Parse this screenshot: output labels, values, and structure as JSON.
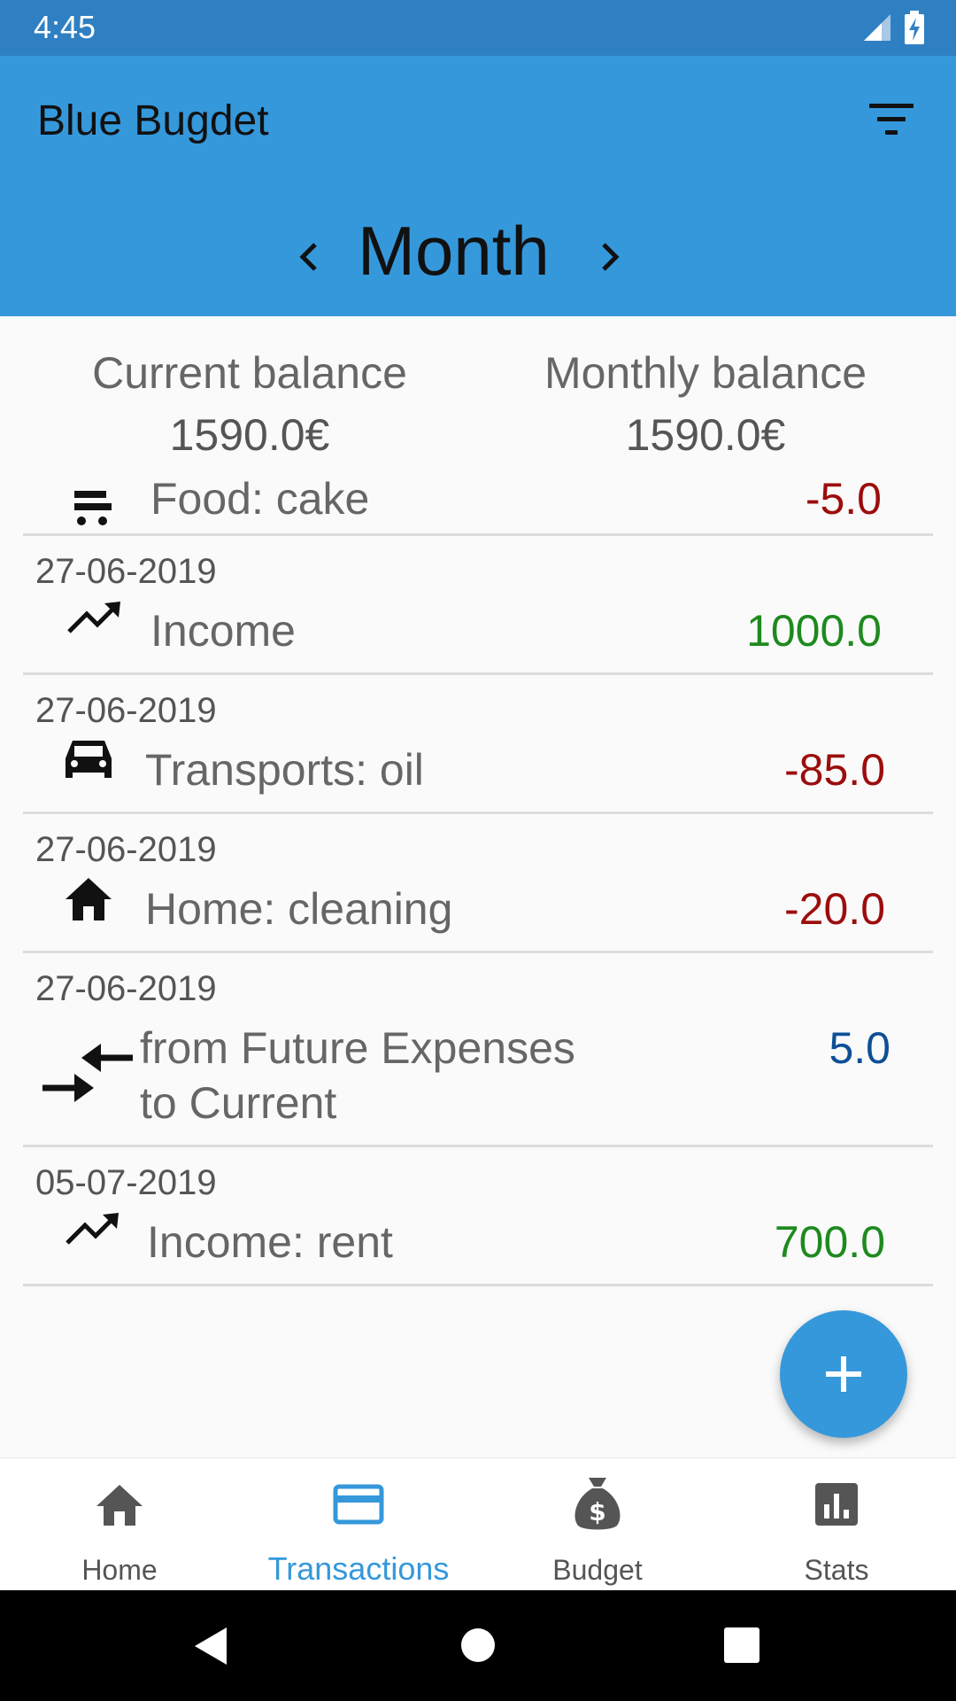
{
  "status_bar": {
    "time": "4:45",
    "icons": [
      "signal-icon",
      "battery-charging-icon"
    ]
  },
  "app_bar": {
    "title": "Blue Bugdet",
    "filter_icon": "filter-icon",
    "period": "Month",
    "prev_icon": "chevron-left-icon",
    "next_icon": "chevron-right-icon"
  },
  "balances": {
    "current": {
      "label": "Current balance",
      "value": "1590.0€"
    },
    "monthly": {
      "label": "Monthly balance",
      "value": "1590.0€"
    }
  },
  "transactions": [
    {
      "date": "",
      "icon": "food-icon",
      "category": "Food: cake",
      "amount": "-5.0",
      "type": "expense"
    },
    {
      "date": "27-06-2019",
      "icon": "trending-up-icon",
      "category": "Income",
      "amount": "1000.0",
      "type": "income"
    },
    {
      "date": "27-06-2019",
      "icon": "car-icon",
      "category": "Transports: oil",
      "amount": "-85.0",
      "type": "expense"
    },
    {
      "date": "27-06-2019",
      "icon": "home-icon",
      "category": "Home: cleaning",
      "amount": "-20.0",
      "type": "expense"
    },
    {
      "date": "27-06-2019",
      "icon": "transfer-icon",
      "category_line1": "from Future Expenses",
      "category_line2": "to Current",
      "amount": "5.0",
      "type": "transfer"
    },
    {
      "date": "05-07-2019",
      "icon": "trending-up-icon",
      "category": "Income: rent",
      "amount": "700.0",
      "type": "income"
    }
  ],
  "fab": {
    "icon": "plus-icon"
  },
  "bottom_nav": {
    "active": "Transactions",
    "items": [
      {
        "label": "Home",
        "icon": "home-icon"
      },
      {
        "label": "Transactions",
        "icon": "credit-card-icon"
      },
      {
        "label": "Budget",
        "icon": "money-bag-icon"
      },
      {
        "label": "Stats",
        "icon": "bar-chart-icon"
      }
    ]
  },
  "colors": {
    "primary": "#3598db",
    "status_bar": "#2f80c2",
    "income": "#1e8a1e",
    "expense": "#9c0d0d",
    "transfer": "#0d4f96",
    "nav_active": "#3598db",
    "nav_inactive": "#555555"
  }
}
